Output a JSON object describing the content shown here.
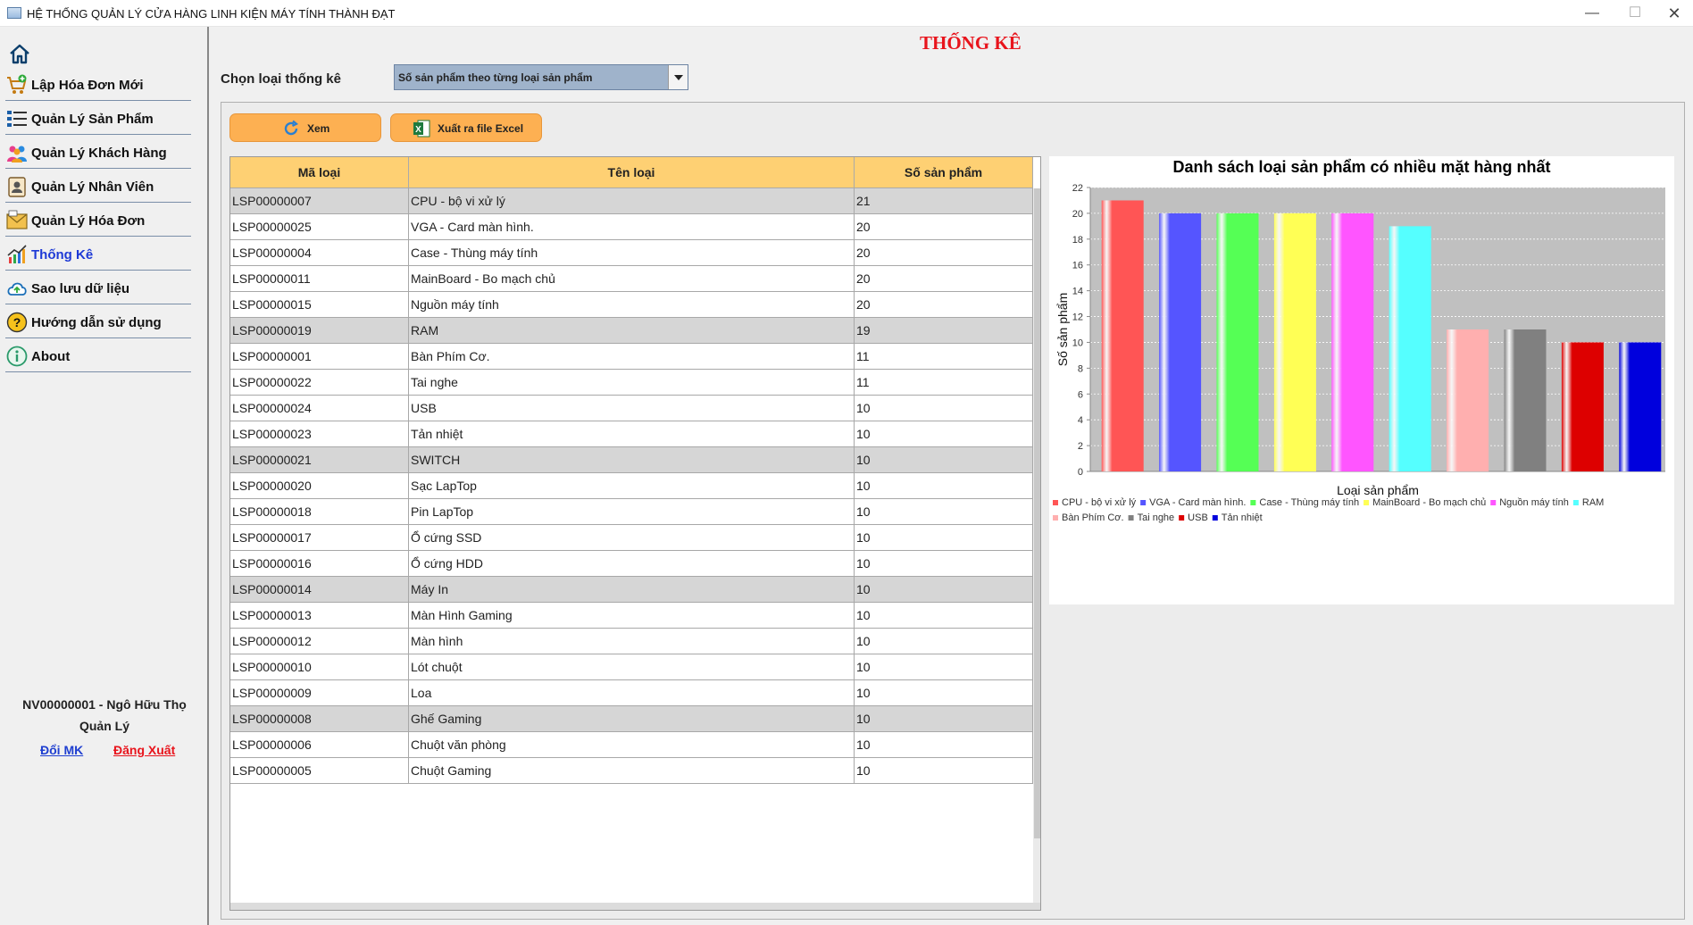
{
  "window": {
    "title": "HỆ THỐNG QUẢN LÝ CỬA HÀNG LINH KIỆN MÁY TÍNH THÀNH ĐẠT",
    "min_label": "—",
    "max_label": "☐",
    "close_label": "✕"
  },
  "sidebar": {
    "items": [
      {
        "label": "Lập Hóa Đơn Mới",
        "icon": "cart-add-icon"
      },
      {
        "label": "Quản Lý Sản Phẩm",
        "icon": "list-icon"
      },
      {
        "label": "Quản Lý Khách Hàng",
        "icon": "customers-icon"
      },
      {
        "label": "Quản Lý Nhân Viên",
        "icon": "employee-icon"
      },
      {
        "label": "Quản Lý Hóa Đơn",
        "icon": "bill-icon"
      },
      {
        "label": "Thống Kê",
        "icon": "statistics-icon"
      },
      {
        "label": "Sao lưu dữ liệu",
        "icon": "backup-icon"
      },
      {
        "label": "Hướng dẫn sử dụng",
        "icon": "help-icon"
      },
      {
        "label": "About",
        "icon": "info-icon"
      }
    ],
    "user_line": "NV00000001 - Ngô Hữu  Thọ",
    "role": "Quản Lý",
    "change_password": "Đổi MK",
    "logout": "Đăng Xuất"
  },
  "main": {
    "title": "THỐNG KÊ",
    "select_label": "Chọn loại thống kê",
    "select_value": "Số sản phẩm theo từng loại sản phẩm",
    "view_button": "Xem",
    "export_button": "Xuất ra file Excel",
    "colors": {
      "accent_orange": "#fdb052",
      "header_yellow": "#fed073",
      "title_red": "#e8141c"
    }
  },
  "table": {
    "headers": [
      "Mã loại",
      "Tên loại",
      "Số sản phẩm"
    ],
    "rows": [
      [
        "LSP00000007",
        "CPU - bộ vi xử lý",
        "21"
      ],
      [
        "LSP00000025",
        "VGA - Card màn hình.",
        "20"
      ],
      [
        "LSP00000004",
        "Case - Thùng máy tính",
        "20"
      ],
      [
        "LSP00000011",
        "MainBoard - Bo mạch chủ",
        "20"
      ],
      [
        "LSP00000015",
        "Nguồn máy tính",
        "20"
      ],
      [
        "LSP00000019",
        "RAM",
        "19"
      ],
      [
        "LSP00000001",
        "Bàn Phím Cơ.",
        "11"
      ],
      [
        "LSP00000022",
        "Tai nghe",
        "11"
      ],
      [
        "LSP00000024",
        "USB",
        "10"
      ],
      [
        "LSP00000023",
        "Tản nhiệt",
        "10"
      ],
      [
        "LSP00000021",
        "SWITCH",
        "10"
      ],
      [
        "LSP00000020",
        "Sạc LapTop",
        "10"
      ],
      [
        "LSP00000018",
        "Pin LapTop",
        "10"
      ],
      [
        "LSP00000017",
        "Ổ cứng SSD",
        "10"
      ],
      [
        "LSP00000016",
        "Ổ cứng HDD",
        "10"
      ],
      [
        "LSP00000014",
        "Máy In",
        "10"
      ],
      [
        "LSP00000013",
        "Màn Hình Gaming",
        "10"
      ],
      [
        "LSP00000012",
        "Màn hình",
        "10"
      ],
      [
        "LSP00000010",
        "Lót chuột",
        "10"
      ],
      [
        "LSP00000009",
        "Loa",
        "10"
      ],
      [
        "LSP00000008",
        "Ghế Gaming",
        "10"
      ],
      [
        "LSP00000006",
        "Chuột văn phòng",
        "10"
      ],
      [
        "LSP00000005",
        "Chuột Gaming",
        "10"
      ]
    ],
    "grey_rows": [
      0,
      5,
      10,
      15,
      20
    ]
  },
  "chart_data": {
    "type": "bar",
    "title": "Danh sách loại sản phẩm có nhiều mặt hàng nhất",
    "xlabel": "Loại sản phẩm",
    "ylabel": "Số sản phẩm",
    "ylim": [
      0,
      22
    ],
    "yticks": [
      0,
      2,
      4,
      6,
      8,
      10,
      12,
      14,
      16,
      18,
      20,
      22
    ],
    "grid": true,
    "legend_position": "bottom",
    "series": [
      {
        "name": "CPU - bộ vi xử lý",
        "value": 21,
        "color": "#ff5555"
      },
      {
        "name": "VGA - Card màn hình.",
        "value": 20,
        "color": "#5555ff"
      },
      {
        "name": "Case - Thùng máy tính",
        "value": 20,
        "color": "#55ff55"
      },
      {
        "name": "MainBoard - Bo mạch chủ",
        "value": 20,
        "color": "#ffff55"
      },
      {
        "name": "Nguồn máy tính",
        "value": 20,
        "color": "#ff55ff"
      },
      {
        "name": "RAM",
        "value": 19,
        "color": "#55ffff"
      },
      {
        "name": "Bàn Phím Cơ.",
        "value": 11,
        "color": "#ffafaf"
      },
      {
        "name": "Tai nghe",
        "value": 11,
        "color": "#808080"
      },
      {
        "name": "USB",
        "value": 10,
        "color": "#dd0000"
      },
      {
        "name": "Tản nhiệt",
        "value": 10,
        "color": "#0000dd"
      }
    ]
  }
}
